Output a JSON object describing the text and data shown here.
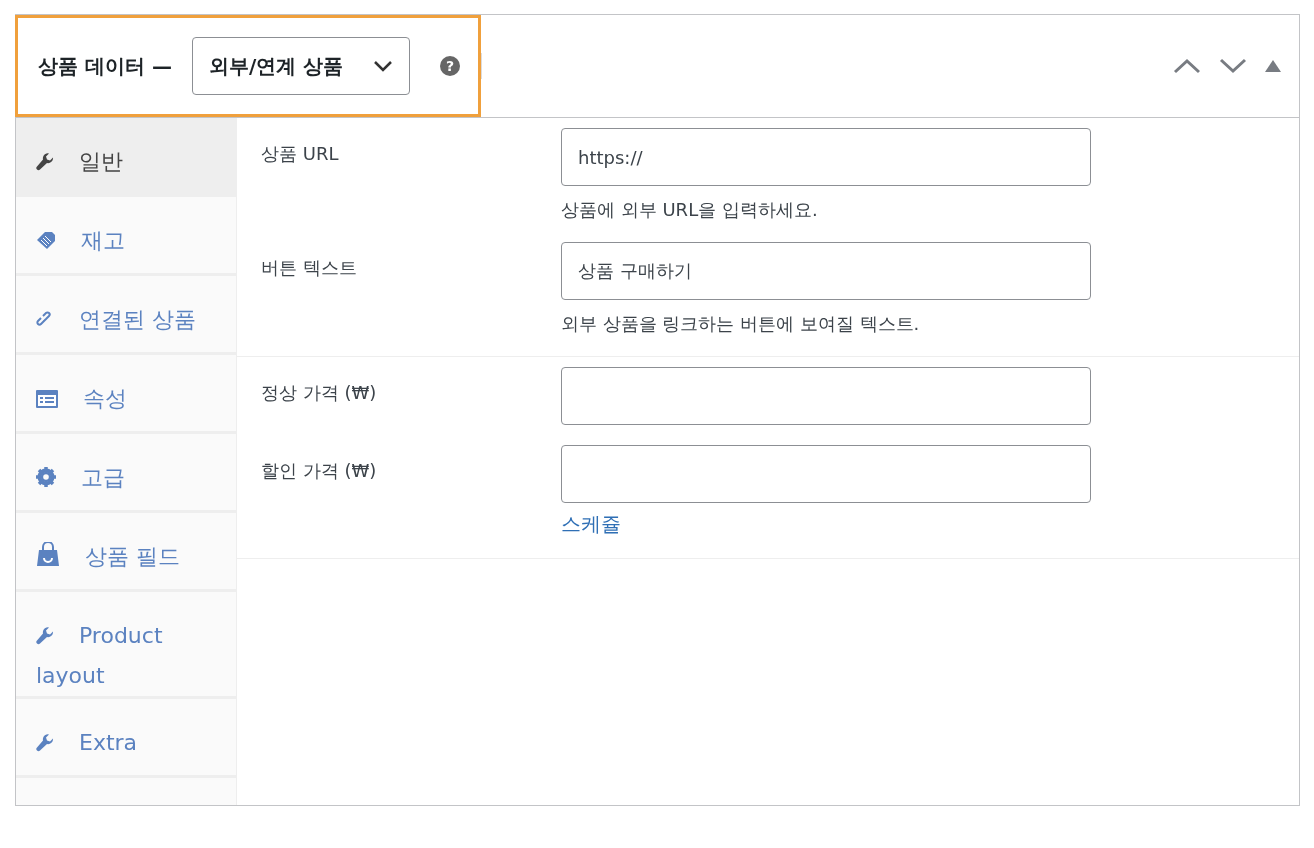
{
  "header": {
    "title": "상품 데이터 —",
    "product_type": "외부/연계 상품",
    "highlighted": true,
    "help": "?"
  },
  "sidebar": {
    "items": [
      {
        "label": "일반",
        "selected": true
      },
      {
        "label": "재고",
        "selected": false
      },
      {
        "label": "연결된 상품",
        "selected": false
      },
      {
        "label": "속성",
        "selected": false
      },
      {
        "label": "고급",
        "selected": false
      },
      {
        "label": "상품 필드",
        "selected": false
      },
      {
        "label": "Product layout",
        "selected": false
      },
      {
        "label": "Extra",
        "selected": false
      }
    ]
  },
  "sections": [
    {
      "fields": [
        {
          "label": "상품 URL",
          "value": "https://",
          "description": "상품에 외부 URL을 입력하세요."
        },
        {
          "label": "버튼 텍스트",
          "value": "상품 구매하기",
          "description": "외부 상품을 링크하는 버튼에 보여질 텍스트."
        }
      ]
    },
    {
      "fields": [
        {
          "label": "정상 가격 (₩)"
        },
        {
          "label": "할인 가격 (₩)",
          "link": "스케쥴"
        }
      ]
    }
  ]
}
